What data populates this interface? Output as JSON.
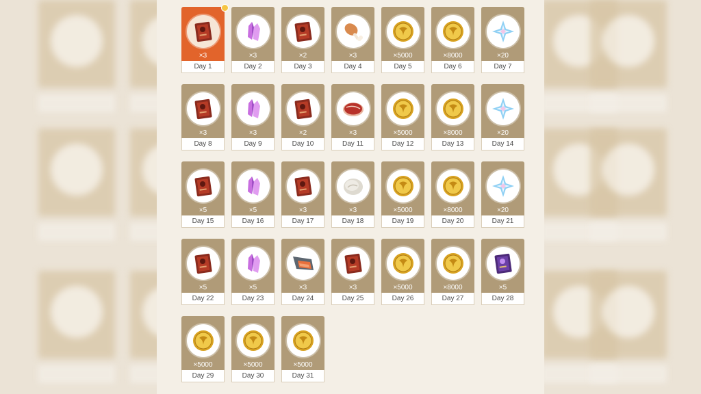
{
  "calendar": {
    "days": [
      {
        "day": "Day 1",
        "qty": "×3",
        "item": "hero-wit-book-icon",
        "selected": true
      },
      {
        "day": "Day 2",
        "qty": "×3",
        "item": "crystal-icon"
      },
      {
        "day": "Day 3",
        "qty": "×2",
        "item": "hero-wit-book-icon"
      },
      {
        "day": "Day 4",
        "qty": "×3",
        "item": "fowl-drumstick-icon"
      },
      {
        "day": "Day 5",
        "qty": "×5000",
        "item": "mora-coin-icon"
      },
      {
        "day": "Day 6",
        "qty": "×8000",
        "item": "mora-coin-icon"
      },
      {
        "day": "Day 7",
        "qty": "×20",
        "item": "primogem-icon"
      },
      {
        "day": "Day 8",
        "qty": "×3",
        "item": "hero-wit-book-icon"
      },
      {
        "day": "Day 9",
        "qty": "×3",
        "item": "crystal-icon"
      },
      {
        "day": "Day 10",
        "qty": "×2",
        "item": "hero-wit-book-icon"
      },
      {
        "day": "Day 11",
        "qty": "×3",
        "item": "raw-meat-icon"
      },
      {
        "day": "Day 12",
        "qty": "×5000",
        "item": "mora-coin-icon"
      },
      {
        "day": "Day 13",
        "qty": "×8000",
        "item": "mora-coin-icon"
      },
      {
        "day": "Day 14",
        "qty": "×20",
        "item": "primogem-icon"
      },
      {
        "day": "Day 15",
        "qty": "×5",
        "item": "hero-wit-book-icon"
      },
      {
        "day": "Day 16",
        "qty": "×5",
        "item": "crystal-icon"
      },
      {
        "day": "Day 17",
        "qty": "×3",
        "item": "hero-wit-book-icon"
      },
      {
        "day": "Day 18",
        "qty": "×3",
        "item": "flour-icon"
      },
      {
        "day": "Day 19",
        "qty": "×5000",
        "item": "mora-coin-icon"
      },
      {
        "day": "Day 20",
        "qty": "×8000",
        "item": "mora-coin-icon"
      },
      {
        "day": "Day 21",
        "qty": "×20",
        "item": "primogem-icon"
      },
      {
        "day": "Day 22",
        "qty": "×5",
        "item": "hero-wit-book-icon"
      },
      {
        "day": "Day 23",
        "qty": "×5",
        "item": "crystal-icon"
      },
      {
        "day": "Day 24",
        "qty": "×3",
        "item": "fish-icon"
      },
      {
        "day": "Day 25",
        "qty": "×3",
        "item": "hero-wit-book-icon"
      },
      {
        "day": "Day 26",
        "qty": "×5000",
        "item": "mora-coin-icon"
      },
      {
        "day": "Day 27",
        "qty": "×8000",
        "item": "mora-coin-icon"
      },
      {
        "day": "Day 28",
        "qty": "×5",
        "item": "purple-book-icon"
      },
      {
        "day": "Day 29",
        "qty": "×5000",
        "item": "mora-coin-icon"
      },
      {
        "day": "Day 30",
        "qty": "×5000",
        "item": "mora-coin-icon"
      },
      {
        "day": "Day 31",
        "qty": "×5000",
        "item": "mora-coin-icon"
      }
    ]
  },
  "colors": {
    "card": "#b09b78",
    "selected_card": "#e2642b",
    "background": "#ebe3d6",
    "notification": "#f5c542"
  }
}
